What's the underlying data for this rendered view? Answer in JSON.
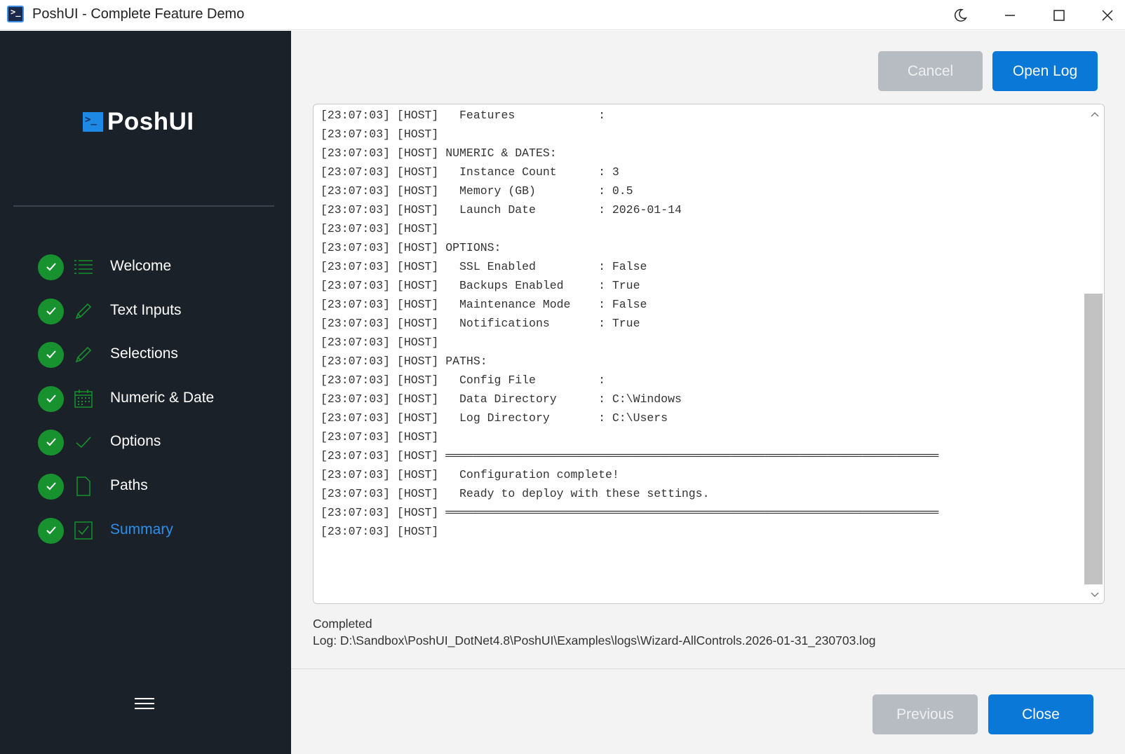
{
  "window": {
    "title": "PoshUI - Complete Feature Demo"
  },
  "sidebar": {
    "logo_text": "PoshUI",
    "steps": [
      {
        "label": "Welcome",
        "icon": "list-icon",
        "active": false
      },
      {
        "label": "Text Inputs",
        "icon": "pencil-icon",
        "active": false
      },
      {
        "label": "Selections",
        "icon": "pencil-icon",
        "active": false
      },
      {
        "label": "Numeric & Date",
        "icon": "calendar-icon",
        "active": false
      },
      {
        "label": "Options",
        "icon": "check-icon",
        "active": false
      },
      {
        "label": "Paths",
        "icon": "document-icon",
        "active": false
      },
      {
        "label": "Summary",
        "icon": "checkbox-icon",
        "active": true
      }
    ]
  },
  "toolbar": {
    "cancel_label": "Cancel",
    "open_log_label": "Open Log"
  },
  "log": {
    "lines": [
      "[23:07:03] [HOST]   Features            :",
      "[23:07:03] [HOST]",
      "[23:07:03] [HOST] NUMERIC & DATES:",
      "[23:07:03] [HOST]   Instance Count      : 3",
      "[23:07:03] [HOST]   Memory (GB)         : 0.5",
      "[23:07:03] [HOST]   Launch Date         : 2026-01-14",
      "[23:07:03] [HOST]",
      "[23:07:03] [HOST] OPTIONS:",
      "[23:07:03] [HOST]   SSL Enabled         : False",
      "[23:07:03] [HOST]   Backups Enabled     : True",
      "[23:07:03] [HOST]   Maintenance Mode    : False",
      "[23:07:03] [HOST]   Notifications       : True",
      "[23:07:03] [HOST]",
      "[23:07:03] [HOST] PATHS:",
      "[23:07:03] [HOST]   Config File         :",
      "[23:07:03] [HOST]   Data Directory      : C:\\Windows",
      "[23:07:03] [HOST]   Log Directory       : C:\\Users",
      "[23:07:03] [HOST]",
      "[23:07:03] [HOST] ═══════════════════════════════════════════════════════════════════════",
      "[23:07:03] [HOST]   Configuration complete!",
      "[23:07:03] [HOST]   Ready to deploy with these settings.",
      "[23:07:03] [HOST] ═══════════════════════════════════════════════════════════════════════",
      "[23:07:03] [HOST]"
    ]
  },
  "status": {
    "state": "Completed",
    "log_path": "Log: D:\\Sandbox\\PoshUI_DotNet4.8\\PoshUI\\Examples\\logs\\Wizard-AllControls.2026-01-31_230703.log"
  },
  "footer": {
    "previous_label": "Previous",
    "close_label": "Close"
  },
  "colors": {
    "sidebar_bg": "#1b2129",
    "accent": "#0a78d6",
    "check_green": "#17922e",
    "active_step": "#2f8fe8"
  }
}
